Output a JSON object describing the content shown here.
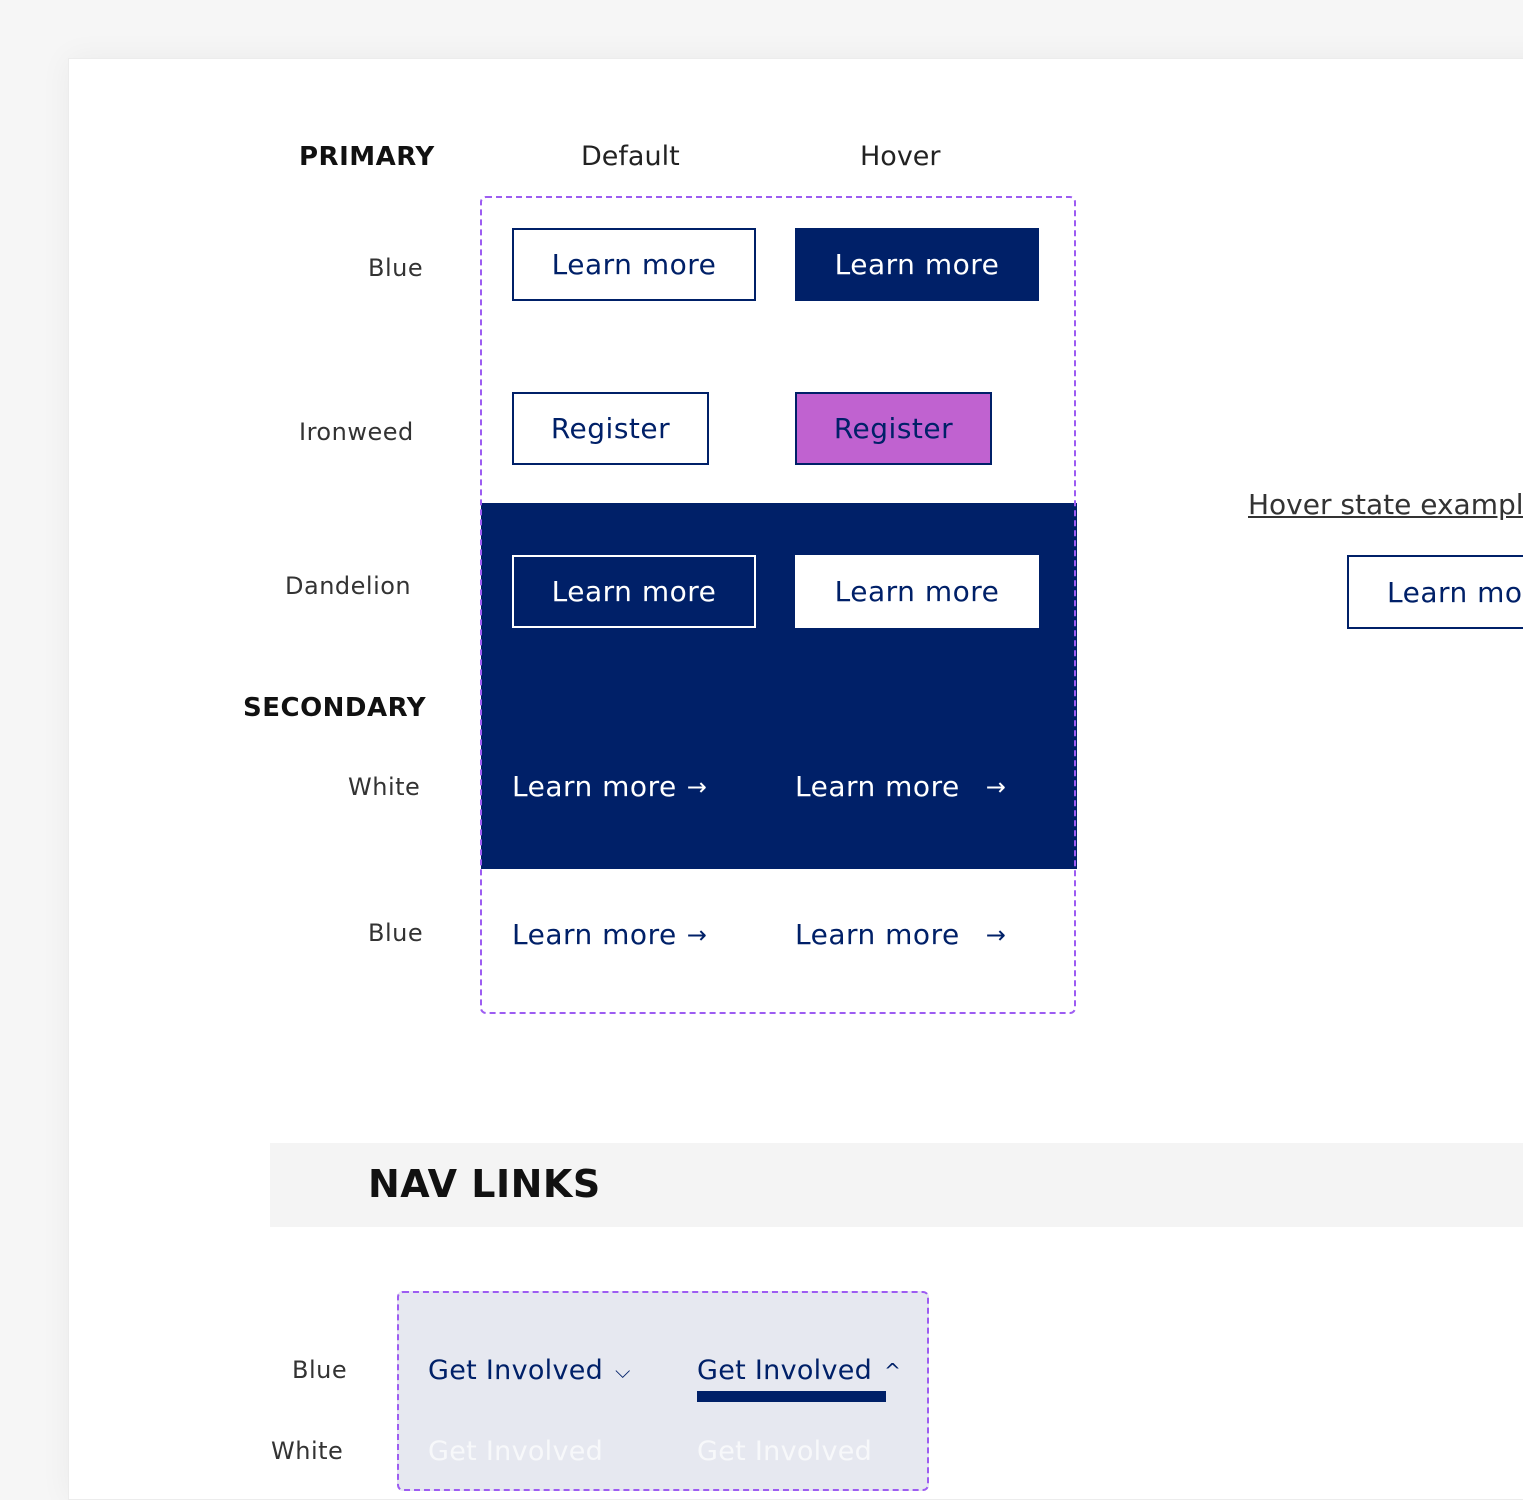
{
  "colors": {
    "navy": "#002068",
    "ironweed": "#c062d0",
    "dashed_frame": "#9d5cf2",
    "band_gray": "#f4f4f4",
    "nav_frame_bg": "#e6e8f0"
  },
  "primary_section": {
    "heading": "PRIMARY",
    "col_default": "Default",
    "col_hover": "Hover",
    "rows": [
      {
        "label": "Blue",
        "default_label": "Learn more",
        "hover_label": "Learn more"
      },
      {
        "label": "Ironweed",
        "default_label": "Register",
        "hover_label": "Register"
      },
      {
        "label": "Dandelion",
        "default_label": "Learn more",
        "hover_label": "Learn more"
      }
    ]
  },
  "secondary_section": {
    "heading": "SECONDARY",
    "arrow_icon": "right-arrow-icon",
    "arrow_glyph": "→",
    "rows": [
      {
        "label": "White",
        "default_label": "Learn more",
        "hover_label": "Learn more"
      },
      {
        "label": "Blue",
        "default_label": "Learn more",
        "hover_label": "Learn more"
      }
    ]
  },
  "hover_example": {
    "label": "Hover state exampl",
    "button_label": "Learn mo"
  },
  "nav_links_section": {
    "heading": "NAV LINKS",
    "rows": [
      {
        "label": "Blue",
        "default_label": "Get Involved",
        "hover_label": "Get Involved",
        "default_icon": "chevron-down-icon",
        "hover_icon": "chevron-up-icon",
        "default_glyph": "⌵",
        "hover_glyph": "^"
      },
      {
        "label": "White",
        "default_label": "Get Involved",
        "hover_label": "Get Involved"
      }
    ]
  }
}
